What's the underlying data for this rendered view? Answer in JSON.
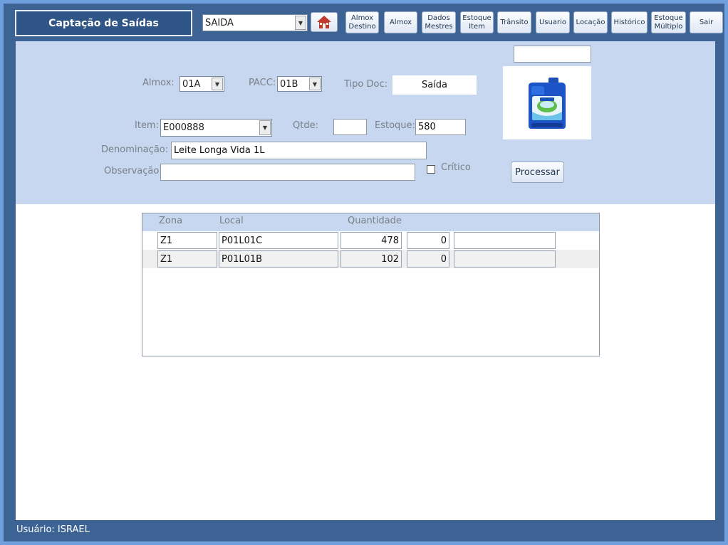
{
  "header": {
    "title": "Captação de Saídas",
    "type_select": {
      "value": "SAIDA"
    },
    "home_icon": "home-icon",
    "buttons": [
      {
        "id": "almox-destino",
        "label": "Almox\nDestino"
      },
      {
        "id": "almox",
        "label": "Almox"
      },
      {
        "id": "dados-mestres",
        "label": "Dados\nMestres"
      },
      {
        "id": "estoque-item",
        "label": "Estoque\nItem"
      },
      {
        "id": "transito",
        "label": "Trânsito"
      },
      {
        "id": "usuario",
        "label": "Usuario"
      },
      {
        "id": "locacao",
        "label": "Locação"
      },
      {
        "id": "historico",
        "label": "Histórico"
      },
      {
        "id": "estoque-multiplo",
        "label": "Estoque\nMúltiplo"
      },
      {
        "id": "sair",
        "label": "Sair"
      }
    ]
  },
  "form": {
    "almox_label": "Almox:",
    "almox_value": "01A",
    "pacc_label": "PACC:",
    "pacc_value": "01B",
    "tipodoc_label": "Tipo Doc:",
    "tipodoc_value": "Saída",
    "item_label": "Item:",
    "item_value": "E000888",
    "qtde_label": "Qtde:",
    "qtde_value": "",
    "estoque_label": "Estoque:",
    "estoque_value": "580",
    "denominacao_label": "Denominação:",
    "denominacao_value": "Leite Longa Vida 1L",
    "observacao_label": "Observação:",
    "observacao_value": "",
    "critico_label": "Crítico",
    "critico_checked": false,
    "top_right_field_value": "",
    "product_image_icon": "product-jug-icon",
    "process_button": "Processar"
  },
  "grid": {
    "columns": [
      "Zona",
      "Local",
      "Quantidade"
    ],
    "rows": [
      {
        "zona": "Z1",
        "local": "P01L01C",
        "quantidade": "478",
        "extra": "0",
        "note": ""
      },
      {
        "zona": "Z1",
        "local": "P01L01B",
        "quantidade": "102",
        "extra": "0",
        "note": ""
      }
    ]
  },
  "footer": {
    "user_label": "Usuário: ISRAEL"
  },
  "colors": {
    "outer_border": "#6f9fdc",
    "frame": "#3d6395",
    "panel": "#c6d7ef",
    "title_bg": "#2f5486"
  }
}
